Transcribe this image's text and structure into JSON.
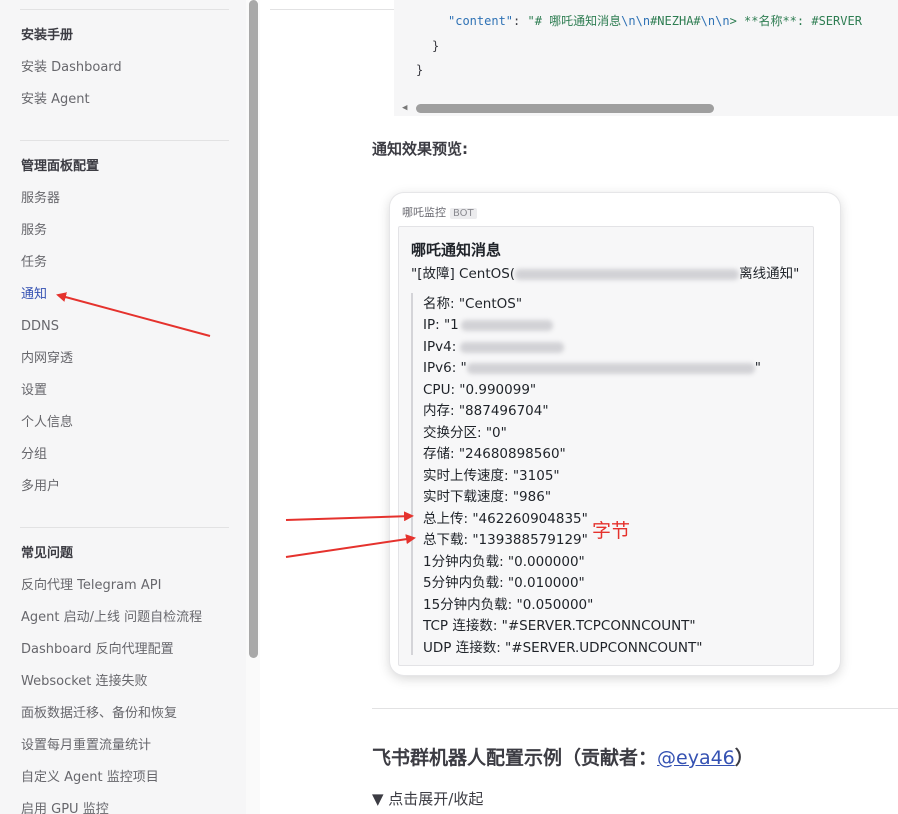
{
  "sidebar": {
    "groups": [
      {
        "heading": "安装手册",
        "items": [
          "安装 Dashboard",
          "安装 Agent"
        ]
      },
      {
        "heading": "管理面板配置",
        "items": [
          "服务器",
          "服务",
          "任务",
          "通知",
          "DDNS",
          "内网穿透",
          "设置",
          "个人信息",
          "分组",
          "多用户"
        ]
      },
      {
        "heading": "常见问题",
        "items": [
          "反向代理 Telegram API",
          "Agent 启动/上线 问题自检流程",
          "Dashboard 反向代理配置",
          "Websocket 连接失败",
          "面板数据迁移、备份和恢复",
          "设置每月重置流量统计",
          "自定义 Agent 监控项目",
          "启用 GPU 监控"
        ]
      }
    ],
    "active_item": "通知"
  },
  "code_block": {
    "line1_key": "\"content\"",
    "line1_colon": ": ",
    "line1_str_a": "\"# 哪吒通知消息",
    "line1_esc_a": "\\n\\n",
    "line1_str_b": "#NEZHA#",
    "line1_esc_b": "\\n\\n",
    "line1_str_c": "> **名称**: #SERVER",
    "line2": "}",
    "line3": "}"
  },
  "preview_label": "通知效果预览:",
  "card": {
    "app_name": "哪吒监控",
    "bot_tag": "BOT",
    "title": "哪吒通知消息",
    "subtitle_prefix": "\"[故障] CentOS(",
    "subtitle_suffix": "离线通知\"",
    "fields": [
      "名称: \"CentOS\"",
      "IP: \"1",
      "IPv4:",
      "IPv6: \"",
      "CPU: \"0.990099\"",
      "内存: \"887496704\"",
      "交换分区: \"0\"",
      "存储: \"24680898560\"",
      "实时上传速度: \"3105\"",
      "实时下载速度: \"986\"",
      "总上传: \"462260904835\"",
      "总下载: \"139388579129\"",
      "1分钟内负载: \"0.000000\"",
      "5分钟内负载: \"0.010000\"",
      "15分钟内负载: \"0.050000\"",
      "TCP 连接数: \"#SERVER.TCPCONNCOUNT\"",
      "UDP 连接数: \"#SERVER.UDPCONNCOUNT\""
    ],
    "ipv6_suffix": "\""
  },
  "annotation": {
    "text": "字节",
    "color": "#e5322d"
  },
  "feishu_section": {
    "heading": "飞书群机器人配置示例（贡献者：",
    "contributor_link": "@eya46",
    "heading_close": "）",
    "details_summary": "▼ 点击展开/收起"
  },
  "colors": {
    "accent": "#3451b2",
    "annotation_red": "#e5322d"
  }
}
